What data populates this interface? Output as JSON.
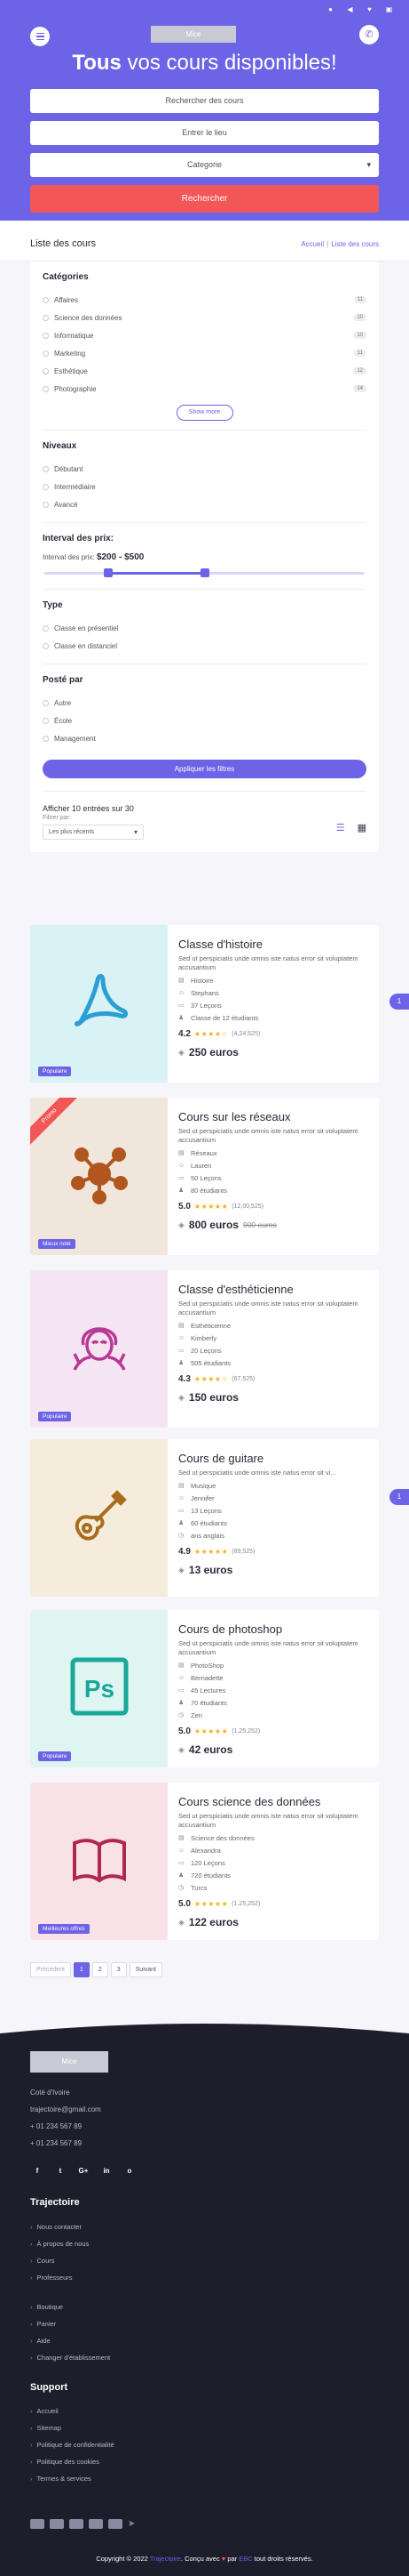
{
  "hero": {
    "logo_text": "Mice",
    "title_bold": "Tous",
    "title_rest": " vos cours disponibles!",
    "search_placeholder": "Rechercher des cours",
    "location_placeholder": "Entrer le lieu",
    "category_value": "Categorie",
    "search_button": "Rechercher"
  },
  "topbar_icons": [
    "user-icon",
    "volume-icon",
    "heart-icon",
    "cart-icon"
  ],
  "breadcrumb": {
    "page_title": "Liste des cours",
    "home": "Accueil",
    "current": "Liste des cours"
  },
  "filters": {
    "categories_title": "Catégories",
    "categories": [
      {
        "label": "Affaires",
        "count": "11"
      },
      {
        "label": "Science des données",
        "count": "10"
      },
      {
        "label": "Informatique",
        "count": "10"
      },
      {
        "label": "Marketing",
        "count": "11"
      },
      {
        "label": "Esthétique",
        "count": "12"
      },
      {
        "label": "Photographie",
        "count": "14"
      }
    ],
    "show_more": "Show more",
    "levels_title": "Niveaux",
    "levels": [
      "Débutant",
      "Intermédiaire",
      "Avancé"
    ],
    "price_title": "Interval des prix:",
    "price_label": "Interval des prix:",
    "price_range": "$200 - $500",
    "price_min": 200,
    "price_max": 500,
    "type_title": "Type",
    "types": [
      "Classe en présentiel",
      "Classe en distanciel"
    ],
    "posted_title": "Posté par",
    "posted_by": [
      "Autre",
      "École",
      "Management"
    ],
    "apply_button": "Appliquer les filtres"
  },
  "results": {
    "count_text": "Afficher 10 entrées sur 30",
    "filter_label": "Filtrer par:",
    "sort_value": "Les plus récents"
  },
  "courses": [
    {
      "title": "Classe d'histoire",
      "desc": "Sed ut perspiciatis unde omnis iste natus error sit voluptatem accusantium",
      "meta": [
        {
          "icon": "category-icon",
          "text": "Histoire"
        },
        {
          "icon": "user-icon",
          "text": "Stephans"
        },
        {
          "icon": "book-icon",
          "text": "37 Leçons"
        },
        {
          "icon": "group-icon",
          "text": "Classe de 12 étudiants"
        }
      ],
      "rating": "4.2",
      "stars": 4,
      "rating_count": "(4,24,525)",
      "price": "250 euros",
      "old_price": "",
      "tag": "Populaire",
      "ribbon": "",
      "thumb_color": "#d8f2f5",
      "icon_color": "#2a9fd6",
      "icon": "acrobat-icon"
    },
    {
      "title": "Cours sur les réseaux",
      "desc": "Sed ut perspiciatis unde omnis iste natus error sit voluptatem accusantium",
      "meta": [
        {
          "icon": "category-icon",
          "text": "Réseaux"
        },
        {
          "icon": "user-icon",
          "text": "Lauren"
        },
        {
          "icon": "book-icon",
          "text": "50 Leçons"
        },
        {
          "icon": "group-icon",
          "text": "80 étudiants"
        }
      ],
      "rating": "5.0",
      "stars": 5,
      "rating_count": "(12,00,525)",
      "price": "800 euros",
      "old_price": "900 euros",
      "tag": "Mieux noté",
      "ribbon": "Promo",
      "thumb_color": "#f1e6dc",
      "icon_color": "#b0561f",
      "icon": "network-icon"
    },
    {
      "title": "Classe d'esthéticienne",
      "desc": "Sed ut perspiciatis unde omnis iste natus error sit voluptatem accusantium",
      "meta": [
        {
          "icon": "category-icon",
          "text": "Esthéticienne"
        },
        {
          "icon": "user-icon",
          "text": "Kimberly"
        },
        {
          "icon": "book-icon",
          "text": "20 Leçons"
        },
        {
          "icon": "group-icon",
          "text": "505 étudiants"
        }
      ],
      "rating": "4.3",
      "stars": 4,
      "rating_count": "(67,525)",
      "price": "150 euros",
      "old_price": "",
      "tag": "Populaire",
      "ribbon": "",
      "thumb_color": "#f5e4f2",
      "icon_color": "#b83a95",
      "icon": "beauty-icon"
    },
    {
      "title": "Cours de guitare",
      "desc": "Sed ut perspiciatis unde omnis iste natus error sit vi...",
      "meta": [
        {
          "icon": "category-icon",
          "text": "Musique"
        },
        {
          "icon": "user-icon",
          "text": "Jennifer"
        },
        {
          "icon": "book-icon",
          "text": "13 Leçons"
        },
        {
          "icon": "group-icon",
          "text": "60 étudiants"
        },
        {
          "icon": "clock-icon",
          "text": "ans anglais"
        }
      ],
      "rating": "4.9",
      "stars": 5,
      "rating_count": "(89,525)",
      "price": "13 euros",
      "old_price": "",
      "tag": "",
      "ribbon": "",
      "thumb_color": "#f5ecdc",
      "icon_color": "#a86d1c",
      "icon": "guitar-icon"
    },
    {
      "title": "Cours de photoshop",
      "desc": "Sed ut perspiciatis unde omnis iste natus error sit voluptatem accusantium",
      "meta": [
        {
          "icon": "category-icon",
          "text": "PhotoShop"
        },
        {
          "icon": "user-icon",
          "text": "Bernadette"
        },
        {
          "icon": "book-icon",
          "text": "45 Lectures"
        },
        {
          "icon": "group-icon",
          "text": "70 étudiants"
        },
        {
          "icon": "clock-icon",
          "text": "Zen"
        }
      ],
      "rating": "5.0",
      "stars": 5,
      "rating_count": "(1,25,252)",
      "price": "42 euros",
      "old_price": "",
      "tag": "Populaire",
      "ribbon": "",
      "thumb_color": "#dff5f2",
      "icon_color": "#1aa89a",
      "icon": "photoshop-icon"
    },
    {
      "title": "Cours science des données",
      "desc": "Sed ut perspiciatis unde omnis iste natus error sit voluptatem accusantium",
      "meta": [
        {
          "icon": "category-icon",
          "text": "Science des données"
        },
        {
          "icon": "user-icon",
          "text": "Alexandra"
        },
        {
          "icon": "book-icon",
          "text": "120 Leçons"
        },
        {
          "icon": "group-icon",
          "text": "720 étudiants"
        },
        {
          "icon": "clock-icon",
          "text": "Turcs"
        }
      ],
      "rating": "5.0",
      "stars": 5,
      "rating_count": "(1,25,252)",
      "price": "122 euros",
      "old_price": "",
      "tag": "Meilleures offres",
      "ribbon": "",
      "thumb_color": "#f8e2e8",
      "icon_color": "#b1284f",
      "icon": "book-open-icon"
    }
  ],
  "side_badge": "1",
  "pagination": {
    "prev": "Précédent",
    "pages": [
      "1",
      "2",
      "3"
    ],
    "next": "Suivant",
    "active": 0
  },
  "footer": {
    "logo_text": "Mice",
    "address": "Coté d'Ivoire",
    "email": "trajectoire@gmail.com",
    "phone1": "+ 01 234 567 89",
    "phone2": "+ 01 234 567 89",
    "social": [
      "f",
      "t",
      "G+",
      "in",
      "o"
    ],
    "title1": "Trajectoire",
    "links1": [
      "Nous contacter",
      "À propos de nous",
      "Cours",
      "Professeurs"
    ],
    "links2": [
      "Boutique",
      "Panier",
      "Aide",
      "Changer d'établissement"
    ],
    "title2": "Support",
    "links3": [
      "Accueil",
      "Sitemap",
      "Politique de confidentialité",
      "Politique des cookies",
      "Termes & services"
    ],
    "copyright_pre": "Copyright © 2022",
    "copyright_brand": "Trajectoire",
    "copyright_mid": ". Conçu avec",
    "copyright_by": "par",
    "copyright_author": "EBC",
    "copyright_post": "tout droits réservés."
  },
  "colors": {
    "primary": "#6c63e6",
    "danger": "#f25656",
    "star": "#f3b01b",
    "footer_bg": "#1d1d2c"
  }
}
